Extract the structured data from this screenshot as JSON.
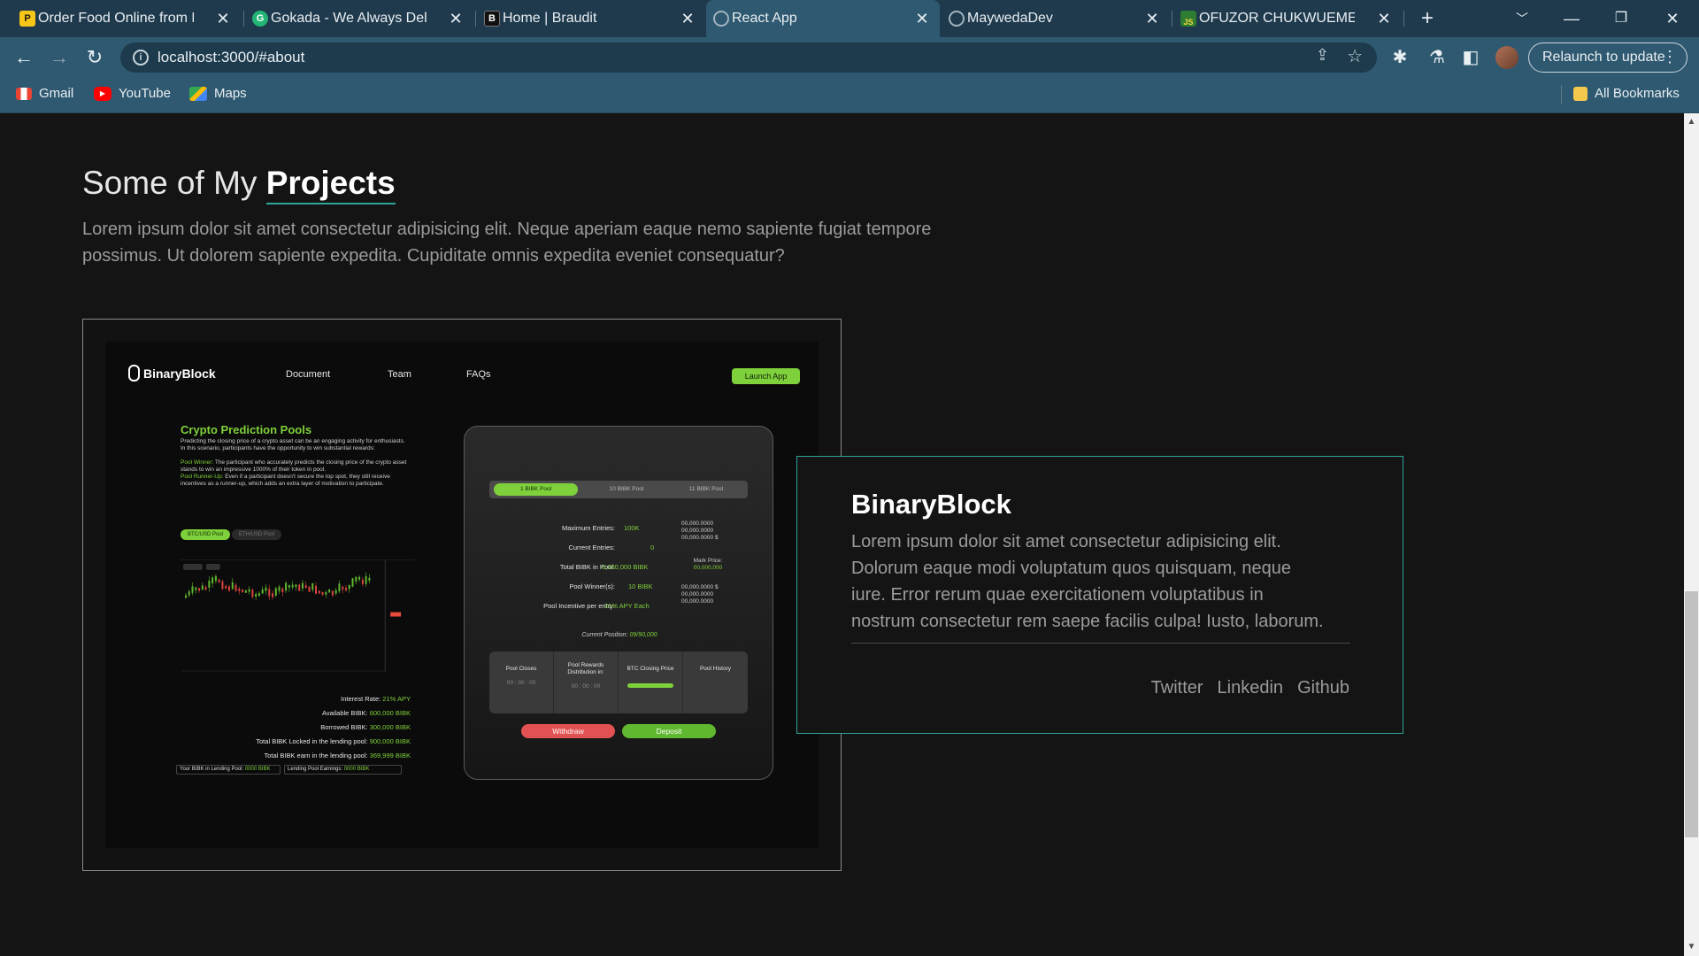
{
  "browser": {
    "tabs": [
      {
        "title": "Order Food Online from R",
        "favicon": "chowdeck-icon",
        "color": "#f5c518"
      },
      {
        "title": "Gokada - We Always Deliv",
        "favicon": "gokada-icon",
        "color": "#22b573"
      },
      {
        "title": "Home | Braudit",
        "favicon": "braudit-icon",
        "color": "#222222"
      },
      {
        "title": "React App",
        "favicon": "globe-icon",
        "color": "#9fb3bf",
        "active": true
      },
      {
        "title": "MaywedaDev",
        "favicon": "globe-icon",
        "color": "#9fb3bf"
      },
      {
        "title": "OFUZOR CHUKWUEMEKE",
        "favicon": "js-icon",
        "color": "#2e7d32"
      }
    ],
    "url": "localhost:3000/#about",
    "relaunch_label": "Relaunch to update",
    "bookmarks": [
      {
        "label": "Gmail",
        "icon": "gmail-icon"
      },
      {
        "label": "YouTube",
        "icon": "youtube-icon"
      },
      {
        "label": "Maps",
        "icon": "maps-icon"
      }
    ],
    "all_bookmarks_label": "All Bookmarks"
  },
  "page": {
    "heading_prefix": "Some of My",
    "heading_bold": "Projects",
    "lead": "Lorem ipsum dolor sit amet consectetur adipisicing elit. Neque aperiam eaque nemo sapiente fugiat tempore possimus. Ut dolorem sapiente expedita. Cupiditate omnis expedita eveniet consequatur?",
    "accent": "#2fa59a"
  },
  "project": {
    "title": "BinaryBlock",
    "description": "Lorem ipsum dolor sit amet consectetur adipisicing elit. Dolorum eaque modi voluptatum quos quisquam, neque iure. Error rerum quae exercitationem voluptatibus in nostrum consectetur rem saepe facilis culpa! Iusto, laborum.",
    "links": [
      "Twitter",
      "Linkedin",
      "Github"
    ]
  },
  "preview": {
    "logo": "BinaryBlock",
    "nav": [
      "Document",
      "Team",
      "FAQs"
    ],
    "launch": "Launch App",
    "heading": "Crypto Prediction Pools",
    "intro": "Predicting the closing price of a crypto asset can be an engaging activity for enthusiasts. In this scenario, participants have the opportunity to win substantial rewards:",
    "winner_label": "Pool Winner:",
    "winner_text": "The participant who accurately predicts the closing price of the crypto asset stands to win an impressive 1000% of their token in pool.",
    "runner_label": "Pool Runner-Up:",
    "runner_text": "Even if a participant doesn't secure the top spot, they still receive incentives as a runner-up, which adds an extra layer of motivation to participate.",
    "pair_active": "BTC/USD Pool",
    "pair_other": "ETH/USD Pool",
    "stats": [
      {
        "label": "Interest Rate:",
        "value": "21% APY"
      },
      {
        "label": "Available BIBK:",
        "value": "600,000 BIBK"
      },
      {
        "label": "Borrowed BIBK:",
        "value": "300,000 BIBK"
      },
      {
        "label": "Total BIBK Locked in the lending pool:",
        "value": "900,000 BIBK"
      },
      {
        "label": "Total BIBK earn in the lending pool:",
        "value": "369,999 BIBK"
      }
    ],
    "foot_left_label": "Your BIBK in Lending Pool:",
    "foot_left_value": "0000 BIBK",
    "foot_right_label": "Lending Pool Earnings:",
    "foot_right_value": "0000 BIBK",
    "pool_tabs": [
      "1 BIBK Pool",
      "10 BIBK Pool",
      "11 BIBK Pool"
    ],
    "rows": [
      {
        "label": "Maximum Entries:",
        "value": "100K"
      },
      {
        "label": "Current Entries:",
        "value": "0"
      },
      {
        "label": "Total BIBK in Pool:",
        "value": "0,000,000 BIBK"
      },
      {
        "label": "Pool Winner(s):",
        "value": "10 BIBK"
      },
      {
        "label": "Pool Incentive per entry:",
        "value": "21% APY Each"
      }
    ],
    "right_a": "00,000.0000\n00,000.0000\n00,000.0000 $",
    "mark_label": "Mark Price:",
    "mark_value": "00,000,000",
    "right_b": "00,000.0000 $\n00,000.0000\n00,000.0000",
    "current_label": "Current Position:",
    "current_value": "09/90,000",
    "columns": [
      "Pool Closes",
      "Pool Rewards Distribution in:",
      "BTC Closing Price",
      "Pool History"
    ],
    "timer": "00 : 00 : 00",
    "withdraw": "Withdraw",
    "deposit": "Deposit"
  }
}
